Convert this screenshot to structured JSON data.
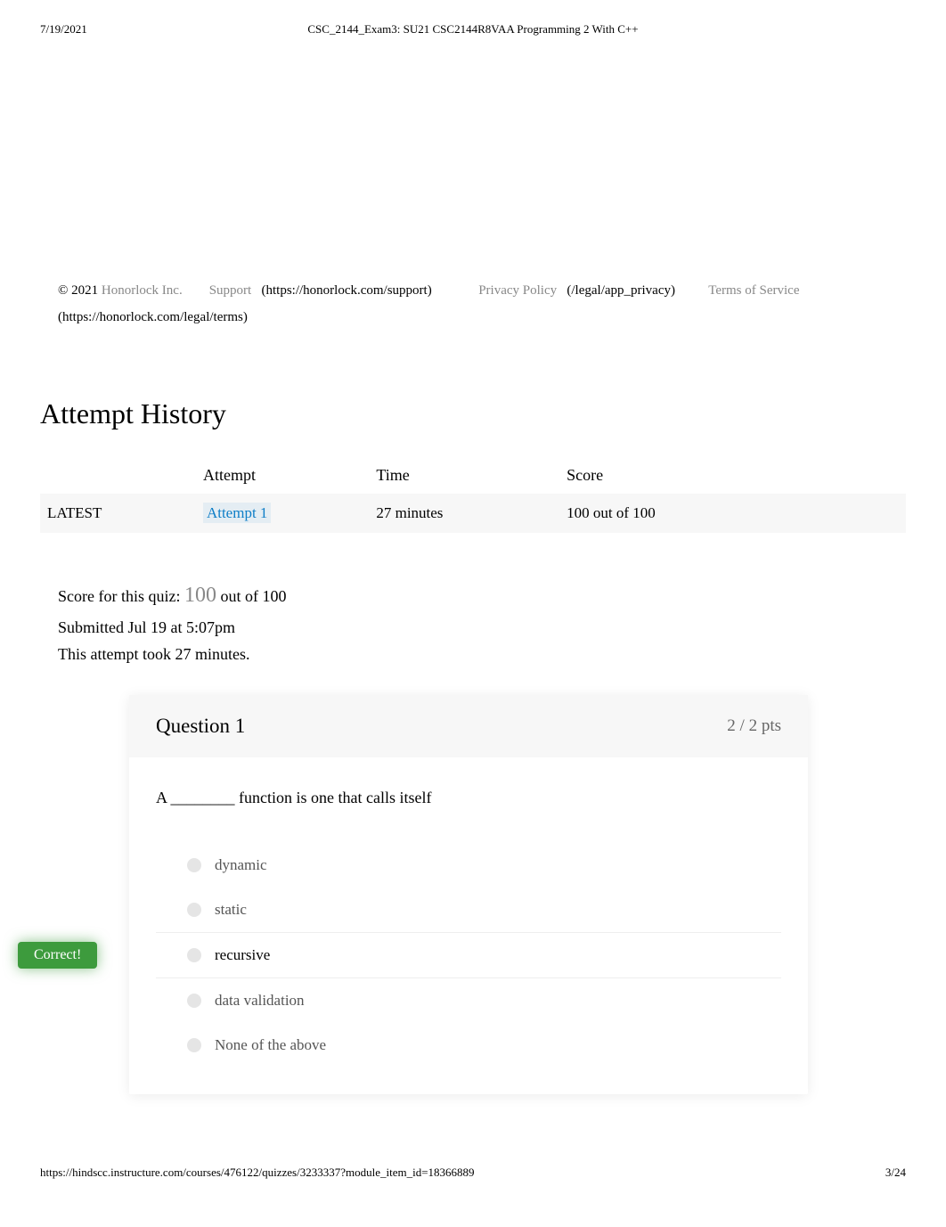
{
  "header": {
    "date": "7/19/2021",
    "title": "CSC_2144_Exam3: SU21 CSC2144R8VAA Programming 2 With C++"
  },
  "legal": {
    "copyright_symbol": "©",
    "year": "2021",
    "company": "Honorlock Inc.",
    "support_label": "Support",
    "support_url": "(https://honorlock.com/support)",
    "privacy_label": "Privacy Policy",
    "privacy_url": "(/legal/app_privacy)",
    "terms_label": "Terms of Service",
    "terms_url": "(https://honorlock.com/legal/terms)"
  },
  "attempt_history": {
    "title": "Attempt History",
    "headers": {
      "status": "",
      "attempt": "Attempt",
      "time": "Time",
      "score": "Score"
    },
    "rows": [
      {
        "status": "LATEST",
        "attempt": "Attempt 1",
        "time": "27 minutes",
        "score": "100 out of 100"
      }
    ]
  },
  "score_summary": {
    "label": "Score for this quiz: ",
    "score": "100",
    "out_of": " out of 100",
    "submitted": "Submitted Jul 19 at 5:07pm",
    "duration": "This attempt took 27 minutes."
  },
  "question": {
    "title": "Question 1",
    "points": "2 / 2 pts",
    "prompt": "A ________ function is one that calls itself",
    "options": [
      {
        "text": "dynamic",
        "selected": false
      },
      {
        "text": "static",
        "selected": false
      },
      {
        "text": "recursive",
        "selected": true
      },
      {
        "text": "data validation",
        "selected": false
      },
      {
        "text": "None of the above",
        "selected": false
      }
    ],
    "correct_label": "Correct!"
  },
  "footer": {
    "url": "https://hindscc.instructure.com/courses/476122/quizzes/3233337?module_item_id=18366889",
    "page": "3/24"
  }
}
